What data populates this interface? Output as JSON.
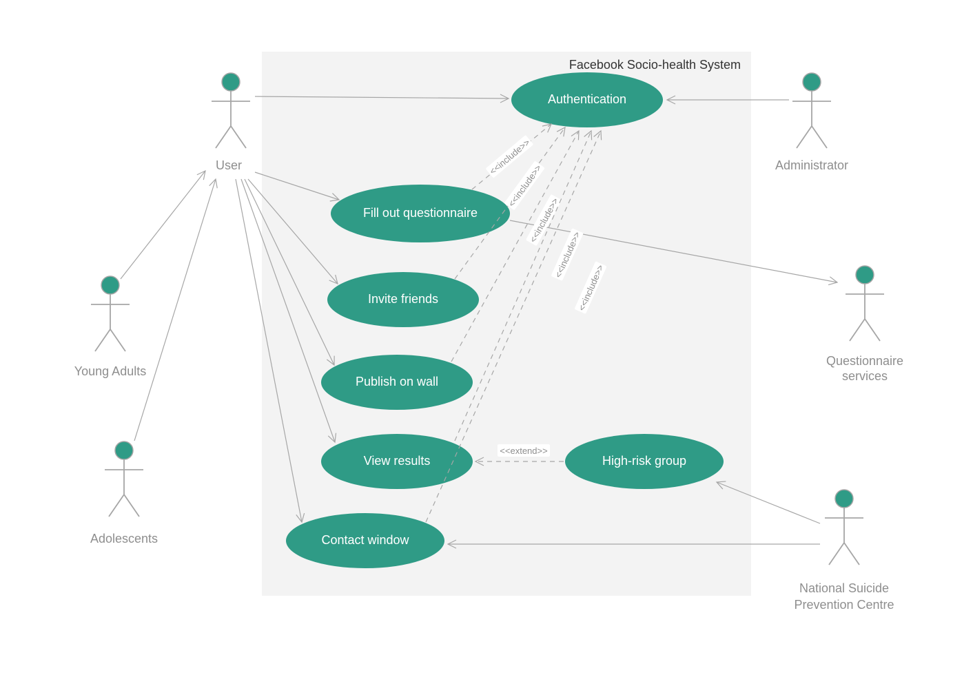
{
  "system": {
    "title": "Facebook Socio-health System"
  },
  "actors": {
    "user": "User",
    "youngAdults": "Young Adults",
    "adolescents": "Adolescents",
    "administrator": "Administrator",
    "questionnaire": "Questionnaire services",
    "nspc_line1": "National Suicide",
    "nspc_line2": "Prevention Centre"
  },
  "usecases": {
    "authentication": "Authentication",
    "fillout": "Fill out questionnaire",
    "invite": "Invite friends",
    "publish": "Publish on wall",
    "viewresults": "View results",
    "contact": "Contact window",
    "highrisk": "High-risk group"
  },
  "stereotypes": {
    "include": "<<include>>",
    "extend": "<<extend>>"
  }
}
